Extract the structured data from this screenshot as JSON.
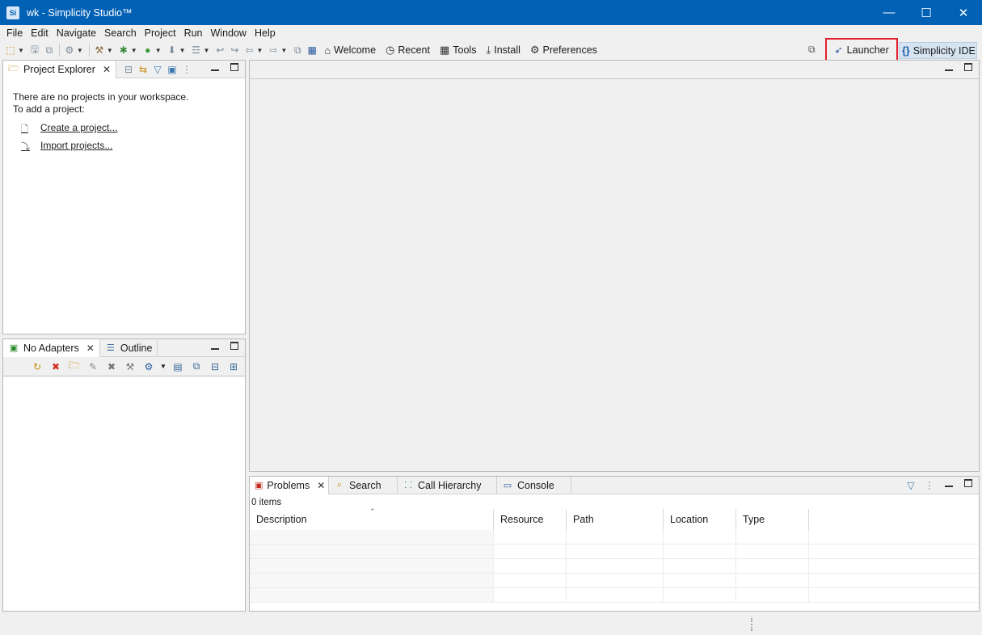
{
  "window": {
    "title": "wk - Simplicity Studio™",
    "app_icon": "Si",
    "controls": [
      "minimize",
      "maximize",
      "close"
    ]
  },
  "menu": [
    "File",
    "Edit",
    "Navigate",
    "Search",
    "Project",
    "Run",
    "Window",
    "Help"
  ],
  "toolbar": {
    "welcome": "Welcome",
    "recent": "Recent",
    "tools": "Tools",
    "install": "Install",
    "preferences": "Preferences",
    "launcher": "Launcher",
    "simplicity_ide": "Simplicity IDE"
  },
  "project_explorer": {
    "tab": "Project Explorer",
    "line1": "There are no projects in your workspace.",
    "line2": "To add a project:",
    "create": "Create a project...",
    "import": "Import projects..."
  },
  "adapters": {
    "tab1": "No Adapters",
    "tab2": "Outline"
  },
  "bottom_panel": {
    "tabs": [
      "Problems",
      "Search",
      "Call Hierarchy",
      "Console"
    ],
    "items": "0 items",
    "columns": [
      "Description",
      "Resource",
      "Path",
      "Location",
      "Type"
    ]
  },
  "colors": {
    "titlebar": "#0161b5",
    "highlight": "#e0202d",
    "active_perspective": "#d6e4f2"
  }
}
